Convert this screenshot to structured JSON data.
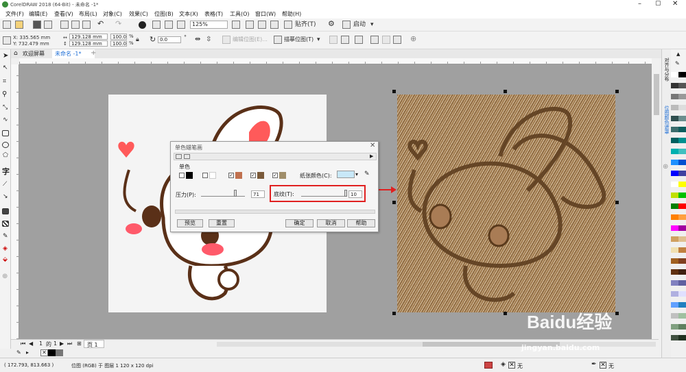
{
  "title": {
    "text": "CorelDRAW 2018 (64-Bit) - 未命名 -1*"
  },
  "menu": {
    "items": [
      "文件(F)",
      "编辑(E)",
      "查看(V)",
      "布局(L)",
      "对象(C)",
      "效果(C)",
      "位图(B)",
      "文本(X)",
      "表格(T)",
      "工具(O)",
      "窗口(W)",
      "帮助(H)"
    ]
  },
  "toolbar": {
    "zoom": "125%",
    "snap_label": "贴齐(T)",
    "launch_label": "启动"
  },
  "propbar": {
    "x": "X: 335.565 mm",
    "y": "Y: 732.479 mm",
    "w": "129.128 mm",
    "h": "129.128 mm",
    "sx": "100.0",
    "sy": "100.0",
    "pct1": "%",
    "pct2": "%",
    "angle": "0.0",
    "deg": "°",
    "edit_bitmap": "编辑位图(E)...",
    "trace_bitmap": "描摹位图(T)"
  },
  "tabs": {
    "welcome": "欢迎屏幕",
    "doc": "未命名 -1*"
  },
  "dialog": {
    "title": "单色蜡笔画",
    "section": "单色",
    "paper_color_label": "纸张颜色(C):",
    "pressure_label": "压力(P):",
    "pressure_value": "71",
    "texture_label": "底纹(T):",
    "texture_value": "10",
    "preview": "预览",
    "reset": "重置",
    "ok": "确定",
    "cancel": "取消",
    "help": "帮助",
    "swatch_colors": [
      "#000000",
      "#ffffff",
      "#c0714f",
      "#7a5a3a",
      "#a08e6a"
    ],
    "paper_color": "#c8e8f8"
  },
  "pager": {
    "current": "1",
    "of": "的",
    "total": "1",
    "page_tab": "页 1"
  },
  "status": {
    "coords": "( 172.793, 813.663 )",
    "info": "位图 (RGB) 于 图层 1 120 x 120 dpi",
    "fill_none": "无",
    "outline_none": "无"
  },
  "dockers": {
    "align": "对齐与分布",
    "bitmap_trace": "位图颜色遮罩"
  },
  "watermark": {
    "brand": "Baidu经验",
    "url": "jingyan.baidu.com"
  },
  "colors": {
    "accent": "#1f6fd6",
    "highlight_red": "#e02020",
    "canvas_bg": "#a0a0a0"
  },
  "palette": [
    "#ffffff",
    "#000000",
    "#333333",
    "#555555",
    "#777777",
    "#999999",
    "#bbbbbb",
    "#dddddd",
    "#2f4f4f",
    "#6b8e8e",
    "#3c6e6e",
    "#0e5e5e",
    "#006060",
    "#009090",
    "#00b0b0",
    "#40c0c0",
    "#1e90ff",
    "#0050d0",
    "#0000ff",
    "#4040a0",
    "#ffffff",
    "#ffff00",
    "#c0e000",
    "#00c000",
    "#008000",
    "#ff0000",
    "#ff8000",
    "#ffa040",
    "#ff00ff",
    "#a000a0",
    "#d0a060",
    "#e0c090",
    "#f0e0b0",
    "#c08040",
    "#a06020",
    "#804020",
    "#603010",
    "#402010",
    "#8080c0",
    "#6060a0",
    "#b0b0e0",
    "#e0e0ff",
    "#60a0ff",
    "#2080c0",
    "#c0c0c0",
    "#a0c0a0",
    "#80a080",
    "#608060",
    "#405040",
    "#203020"
  ]
}
